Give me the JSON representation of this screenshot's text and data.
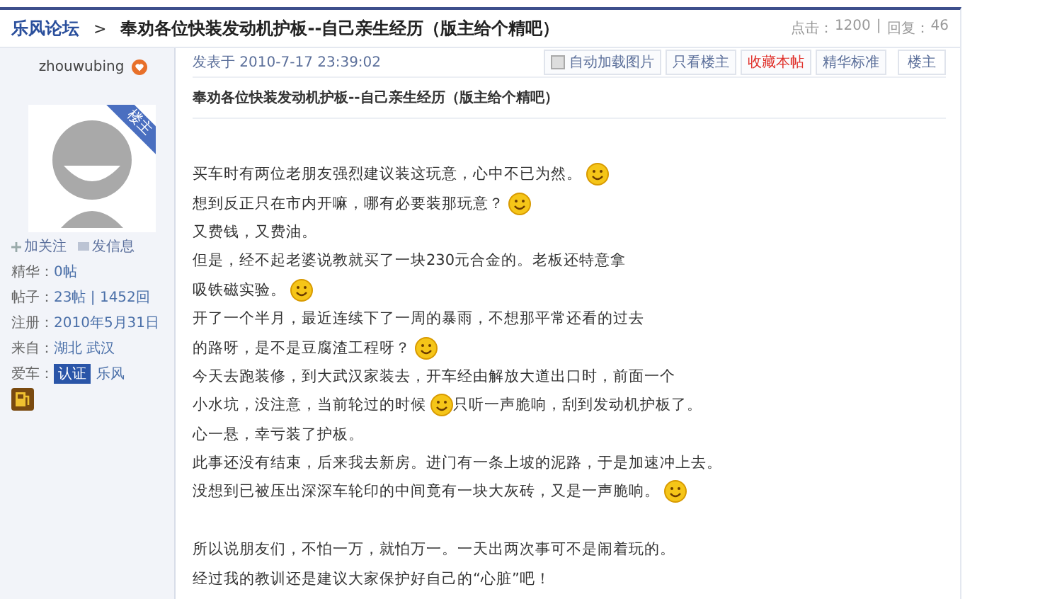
{
  "breadcrumb": {
    "forum": "乐风论坛",
    "separator": ">",
    "title": "奉劝各位快装发动机护板--自己亲生经历（版主给个精吧）"
  },
  "stats": {
    "views_label": "点击：",
    "views": "1200",
    "divider": "|",
    "replies_label": "回复：",
    "replies": "46"
  },
  "author": {
    "name": "zhouwubing",
    "role_badge": "楼主",
    "actions": [
      "加关注",
      "发信息"
    ],
    "info": [
      {
        "label": "精华：",
        "value": "0帖"
      },
      {
        "label": "帖子：",
        "value": "23帖 | 1452回"
      },
      {
        "label": "注册：",
        "value": "2010年5月31日"
      },
      {
        "label": "来自：",
        "value": "湖北 武汉"
      },
      {
        "label": "爱车：",
        "tag": "认证",
        "value": "乐风"
      }
    ]
  },
  "post": {
    "date": "发表于 2010-7-17 23:39:02",
    "tools": [
      {
        "kind": "checkbox",
        "label": "自动加载图片",
        "checked": false
      },
      {
        "kind": "button",
        "label": "只看楼主",
        "highlight": false
      },
      {
        "kind": "button",
        "label": "收藏本帖",
        "highlight": true
      },
      {
        "kind": "button",
        "label": "精华标准",
        "highlight": false
      }
    ],
    "floor": "楼主",
    "title": "奉劝各位快装发动机护板--自己亲生经历（版主给个精吧）",
    "paragraphs": [
      {
        "lines": [
          {
            "segments": [
              {
                "kind": "text",
                "text": "买车时有两位老朋友强烈建议装这玩意，心中不已为然。"
              },
              {
                "kind": "emoji"
              }
            ]
          },
          {
            "segments": [
              {
                "kind": "text",
                "text": "想到反正只在市内开嘛，哪有必要装那玩意？"
              },
              {
                "kind": "emoji"
              }
            ]
          },
          {
            "segments": [
              {
                "kind": "text",
                "text": "又费钱，又费油。"
              }
            ]
          },
          {
            "segments": [
              {
                "kind": "text",
                "text": "但是，经不起老婆说教就买了一块230元合金的。老板还特意拿"
              }
            ]
          },
          {
            "segments": [
              {
                "kind": "text",
                "text": "吸铁磁实验。"
              },
              {
                "kind": "emoji"
              }
            ]
          },
          {
            "segments": [
              {
                "kind": "text",
                "text": "开了一个半月，最近连续下了一周的暴雨，不想那平常还看的过去"
              }
            ]
          },
          {
            "segments": [
              {
                "kind": "text",
                "text": "的路呀，是不是豆腐渣工程呀？"
              },
              {
                "kind": "emoji"
              }
            ]
          },
          {
            "segments": [
              {
                "kind": "text",
                "text": "今天去跑装修，到大武汉家装去，开车经由解放大道出口时，前面一个"
              }
            ]
          },
          {
            "segments": [
              {
                "kind": "text",
                "text": "小水坑，没注意，当前轮过的时候"
              },
              {
                "kind": "emoji"
              },
              {
                "kind": "text",
                "text": "只听一声脆响，刮到发动机护板了。"
              }
            ]
          },
          {
            "segments": [
              {
                "kind": "text",
                "text": "心一悬，幸亏装了护板。"
              }
            ]
          },
          {
            "segments": [
              {
                "kind": "text",
                "text": "此事还没有结束，后来我去新房。进门有一条上坡的泥路，于是加速冲上去。"
              }
            ]
          },
          {
            "segments": [
              {
                "kind": "text",
                "text": "没想到已被压出深深车轮印的中间竟有一块大灰砖，又是一声脆响。"
              },
              {
                "kind": "emoji"
              }
            ]
          }
        ]
      },
      {
        "lines": [
          {
            "segments": [
              {
                "kind": "text",
                "text": "所以说朋友们，不怕一万，就怕万一。一天出两次事可不是闹着玩的。"
              }
            ]
          },
          {
            "segments": [
              {
                "kind": "text",
                "text": "经过我的教训还是建议大家保护好自己的“心脏”吧！"
              }
            ]
          }
        ]
      }
    ]
  }
}
